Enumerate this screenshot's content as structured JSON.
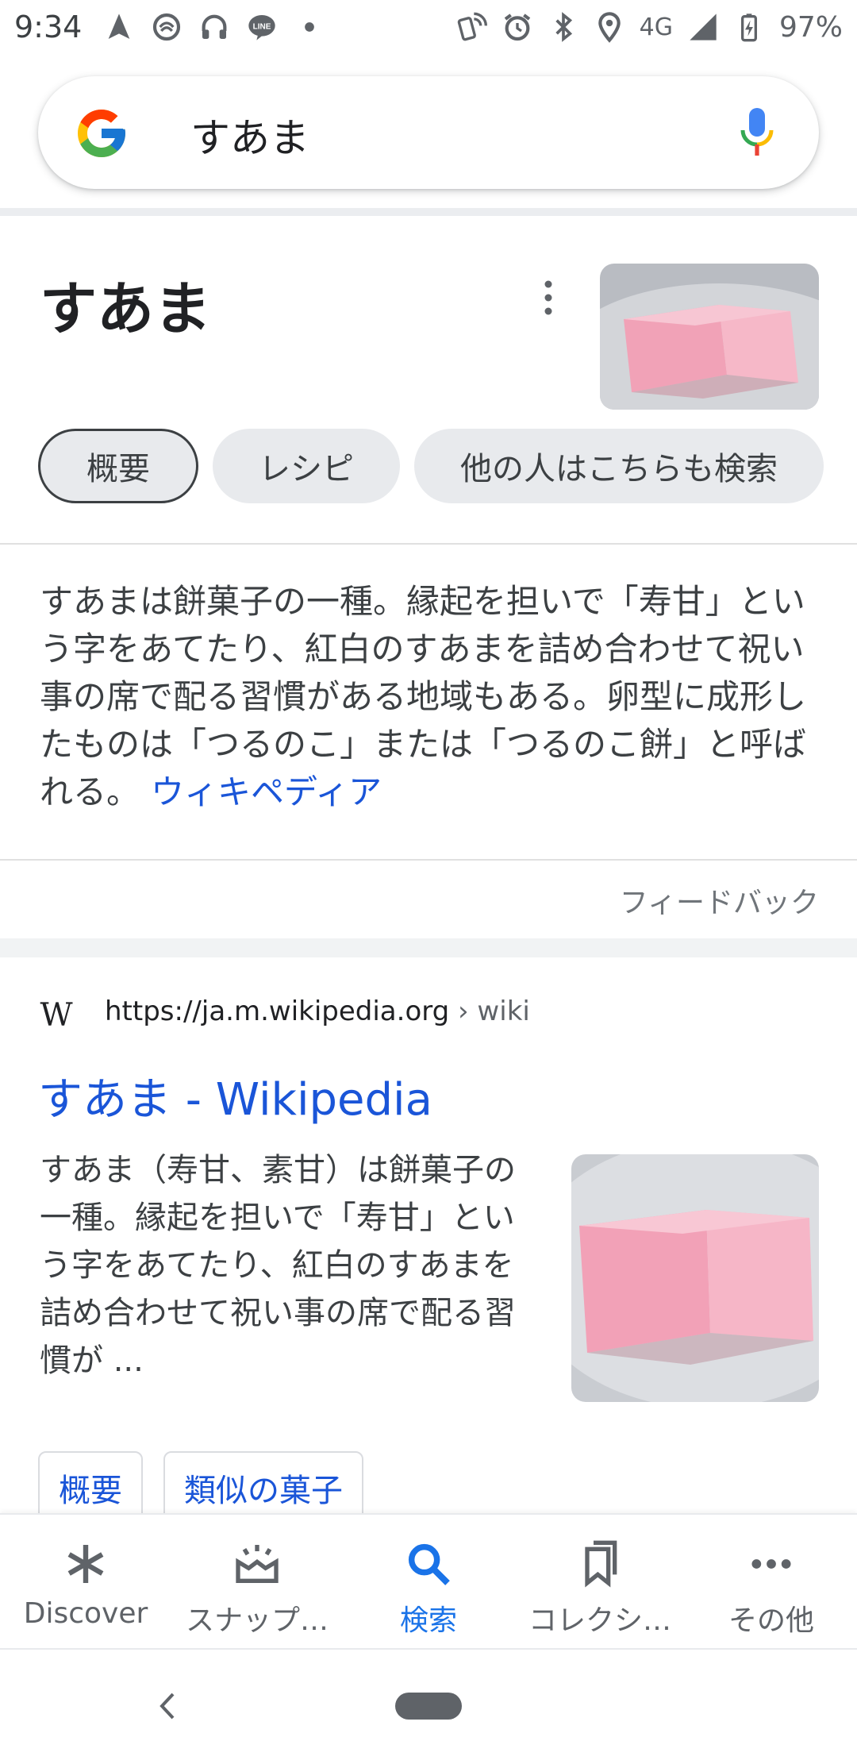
{
  "status_bar": {
    "time": "9:34",
    "network": "4G",
    "battery": "97%",
    "left_icons": [
      "navigation-icon",
      "wallet-icon",
      "headset-icon",
      "line-app-icon",
      "dot-icon"
    ],
    "right_icons": [
      "nfc-icon",
      "alarm-icon",
      "bluetooth-icon",
      "location-icon",
      "signal-icon",
      "battery-icon"
    ]
  },
  "search": {
    "query": "すあま"
  },
  "knowledge_panel": {
    "title": "すあま",
    "chips": [
      {
        "label": "概要",
        "active": true
      },
      {
        "label": "レシピ",
        "active": false
      },
      {
        "label": "他の人はこちらも検索",
        "active": false
      }
    ],
    "description": "すあまは餅菓子の一種。縁起を担いで「寿甘」という字をあてたり、紅白のすあまを詰め合わせて祝い事の席で配る習慣がある地域もある。卵型に成形したものは「つるのこ」または「つるのこ餅」と呼ばれる。",
    "source_link": "ウィキペディア",
    "feedback": "フィードバック"
  },
  "result": {
    "url": "https://ja.m.wikipedia.org",
    "crumb": "› wiki",
    "title": "すあま - Wikipedia",
    "snippet": "すあま（寿甘、素甘）は餅菓子の一種。縁起を担いで「寿甘」という字をあてたり、紅白のすあまを詰め合わせて祝い事の席で配る習慣が ...",
    "chips": [
      "概要",
      "類似の菓子"
    ]
  },
  "bottom_nav": [
    {
      "label": "Discover",
      "icon": "asterisk-icon",
      "active": false
    },
    {
      "label": "スナップ…",
      "icon": "snapshot-icon",
      "active": false
    },
    {
      "label": "検索",
      "icon": "search-icon",
      "active": true
    },
    {
      "label": "コレクシ…",
      "icon": "collections-icon",
      "active": false
    },
    {
      "label": "その他",
      "icon": "more-horizontal-icon",
      "active": false
    }
  ],
  "colors": {
    "link": "#1a55d8",
    "active_nav": "#1a73e8",
    "chip_bg": "#e8eaed"
  }
}
